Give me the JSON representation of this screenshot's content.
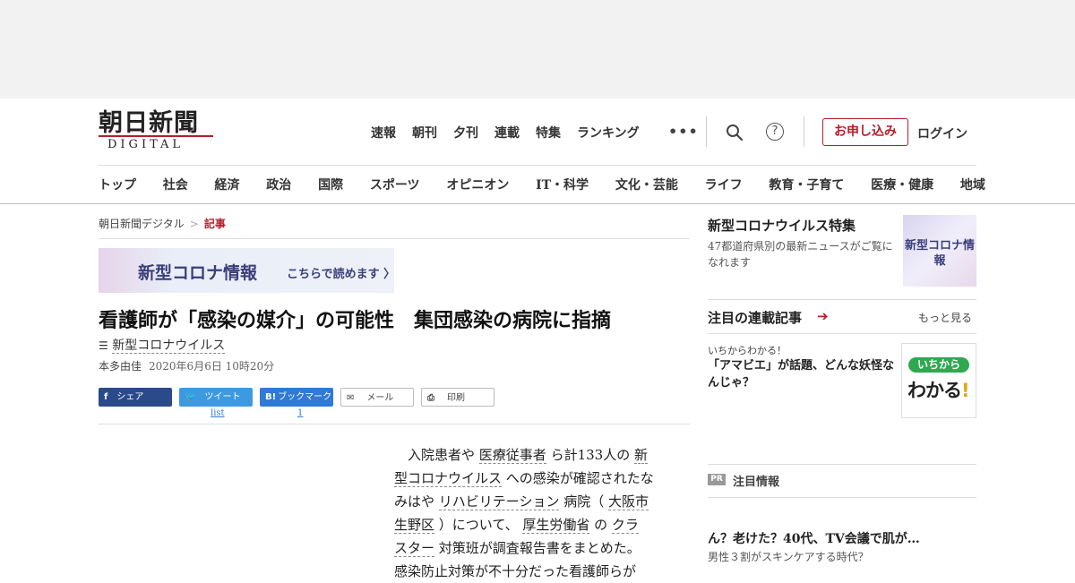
{
  "logo": {
    "jp": "朝日新聞",
    "en": "DIGITAL"
  },
  "topnav": [
    "速報",
    "朝刊",
    "夕刊",
    "連載",
    "特集",
    "ランキング"
  ],
  "header": {
    "more": "•••",
    "signup": "お申し込み",
    "login": "ログイン",
    "help": "?"
  },
  "catnav": [
    "トップ",
    "社会",
    "経済",
    "政治",
    "国際",
    "スポーツ",
    "オピニオン",
    "IT・科学",
    "文化・芸能",
    "ライフ",
    "教育・子育て",
    "医療・健康",
    "地域"
  ],
  "breadcrumb": {
    "home": "朝日新聞デジタル",
    "sep": ">",
    "current": "記事"
  },
  "banner": {
    "title": "新型コロナ情報",
    "cta": "こちらで読めます 〉"
  },
  "article": {
    "headline": "看護師が「感染の媒介」の可能性　集団感染の病院に指摘",
    "tag": "新型コロナウイルス",
    "author": "本多由佳",
    "date": "2020年6月6日 10時20分",
    "body_lines": [
      {
        "parts": [
          {
            "t": "　入院患者や "
          },
          {
            "t": "医療従事者",
            "lk": true
          },
          {
            "t": " ら計133人の "
          },
          {
            "t": "新",
            "lk": true
          }
        ]
      },
      {
        "parts": [
          {
            "t": "型コロナウイルス",
            "lk": true
          },
          {
            "t": " への感染が確認されたな"
          }
        ]
      },
      {
        "parts": [
          {
            "t": "みはや "
          },
          {
            "t": "リハビリテーション",
            "lk": true
          },
          {
            "t": " 病院（ "
          },
          {
            "t": "大阪市",
            "lk": true
          }
        ]
      },
      {
        "parts": [
          {
            "t": "生野区",
            "lk": true
          },
          {
            "t": " ）について、 "
          },
          {
            "t": "厚生労働省",
            "lk": true
          },
          {
            "t": " の "
          },
          {
            "t": "クラ",
            "lk": true
          }
        ]
      },
      {
        "parts": [
          {
            "t": "スター",
            "lk": true
          },
          {
            "t": " 対策班が調査報告書をまとめた。"
          }
        ]
      },
      {
        "parts": [
          {
            "t": "感染防止対策が不十分だった看護師らが"
          }
        ]
      }
    ]
  },
  "share": {
    "facebook": "シェア",
    "twitter": "ツイート",
    "hatena": "ブックマーク",
    "mail": "メール",
    "print": "印刷",
    "twitter_count": "list",
    "hatena_count": "1",
    "fb_icon": "f",
    "tw_icon": "🐦",
    "hb_icon": "B!",
    "mail_icon": "✉",
    "print_icon": "⎙"
  },
  "sidebar": {
    "feature_title": "新型コロナウイルス特集",
    "feature_desc": "47都道府県別の最新ニュースがご覧になれます",
    "feature_thumb": "新型コロナ情報",
    "serial_title": "注目の連載記事",
    "serial_arrow": "➔",
    "serial_more": "もっと見る",
    "serial_kicker": "いちからわかる！",
    "serial_headline": "「アマビエ」が話題、どんな妖怪なんじゃ？",
    "serial_thumb_top": "いちから",
    "serial_thumb_bottom": "わかる",
    "serial_thumb_mark": "!",
    "pr_badge": "PR",
    "pr_label": "注目情報",
    "pr_headline": "ん？老けた？40代、TV会議で肌が…",
    "pr_sub": "男性３割がスキンケアする時代？"
  }
}
